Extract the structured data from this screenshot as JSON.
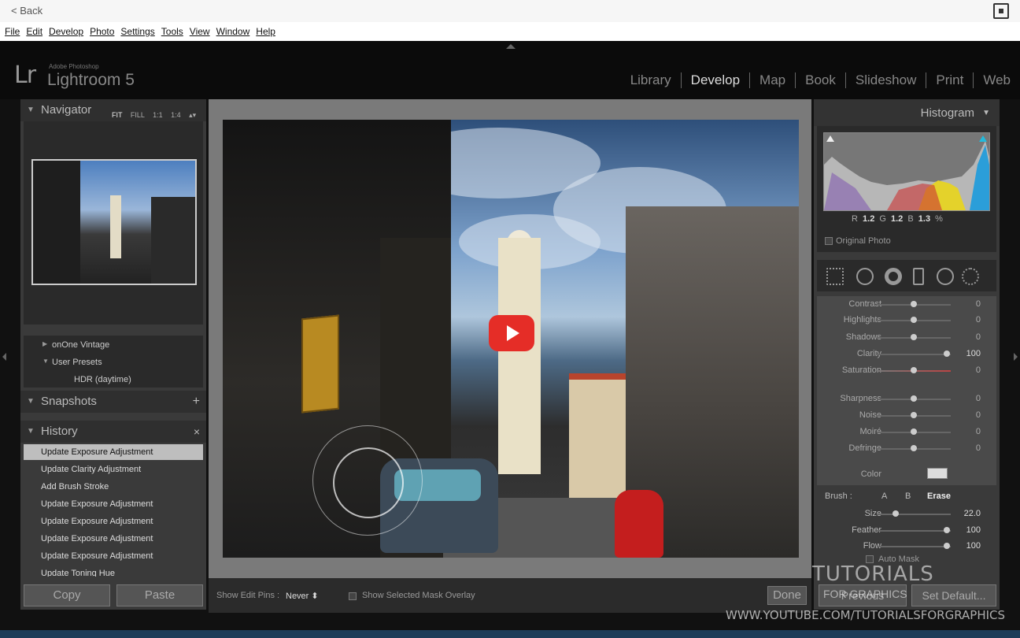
{
  "browser": {
    "back_label": "< Back"
  },
  "menu": [
    "File",
    "Edit",
    "Develop",
    "Photo",
    "Settings",
    "Tools",
    "View",
    "Window",
    "Help"
  ],
  "app": {
    "logo": "Lr",
    "brand_small": "Adobe Photoshop",
    "brand_name": "Lightroom 5"
  },
  "modules": [
    {
      "label": "Library",
      "active": false
    },
    {
      "label": "Develop",
      "active": true
    },
    {
      "label": "Map",
      "active": false
    },
    {
      "label": "Book",
      "active": false
    },
    {
      "label": "Slideshow",
      "active": false
    },
    {
      "label": "Print",
      "active": false
    },
    {
      "label": "Web",
      "active": false
    }
  ],
  "left": {
    "navigator": {
      "title": "Navigator",
      "zoom_options": [
        "FIT",
        "FILL",
        "1:1",
        "1:4 ▴▾"
      ]
    },
    "presets": [
      {
        "label": "onOne Vintage",
        "arrow": "▶"
      },
      {
        "label": "User Presets",
        "arrow": "▼"
      },
      {
        "label": "HDR (daytime)",
        "arrow": ""
      }
    ],
    "snapshots": {
      "title": "Snapshots",
      "action": "+"
    },
    "history": {
      "title": "History",
      "action": "×",
      "items": [
        "Update Exposure Adjustment",
        "Update Clarity Adjustment",
        "Add Brush Stroke",
        "Update Exposure Adjustment",
        "Update Exposure Adjustment",
        "Update Exposure Adjustment",
        "Update Exposure Adjustment",
        "Update Toning Hue"
      ],
      "selected_index": 0
    },
    "copy_label": "Copy",
    "paste_label": "Paste"
  },
  "toolbar": {
    "show_edit_pins_label": "Show Edit Pins :",
    "show_edit_pins_value": "Never ⬍",
    "mask_overlay_label": "Show Selected Mask Overlay",
    "done_label": "Done"
  },
  "right": {
    "histogram_title": "Histogram",
    "rgb": {
      "r_label": "R",
      "r": "1.2",
      "g_label": "G",
      "g": "1.2",
      "b_label": "B",
      "b": "1.3",
      "pct": "%"
    },
    "original_photo_label": "Original Photo",
    "sliders": [
      {
        "name": "Contrast",
        "value": "0",
        "pos": 0.5
      },
      {
        "name": "Highlights",
        "value": "0",
        "pos": 0.5
      },
      {
        "name": "Shadows",
        "value": "0",
        "pos": 0.5
      },
      {
        "name": "Clarity",
        "value": "100",
        "pos": 0.95
      },
      {
        "name": "Saturation",
        "value": "0",
        "pos": 0.5
      },
      {
        "name": "Sharpness",
        "value": "0",
        "pos": 0.5
      },
      {
        "name": "Noise",
        "value": "0",
        "pos": 0.5
      },
      {
        "name": "Moiré",
        "value": "0",
        "pos": 0.5
      },
      {
        "name": "Defringe",
        "value": "0",
        "pos": 0.5
      }
    ],
    "color_label": "Color",
    "brush": {
      "label": "Brush :",
      "options": [
        "A",
        "B",
        "Erase"
      ],
      "size_label": "Size",
      "size_value": "22.0",
      "size_pos": 0.25,
      "feather_label": "Feather",
      "feather_value": "100",
      "feather_pos": 0.95,
      "flow_label": "Flow",
      "flow_value": "100",
      "flow_pos": 0.95,
      "automask_label": "Auto Mask"
    },
    "previous_label": "Previous",
    "set_default_label": "Set Default..."
  },
  "watermark": {
    "line1": "TUTORIALS",
    "line2": "FOR GRAPHICS",
    "url": "WWW.YOUTUBE.COM/TUTORIALSFORGRAPHICS"
  },
  "colors": {
    "accent_red": "#e52d27",
    "panel_bg": "#3a3a3a",
    "selected_row": "#bebebe"
  }
}
